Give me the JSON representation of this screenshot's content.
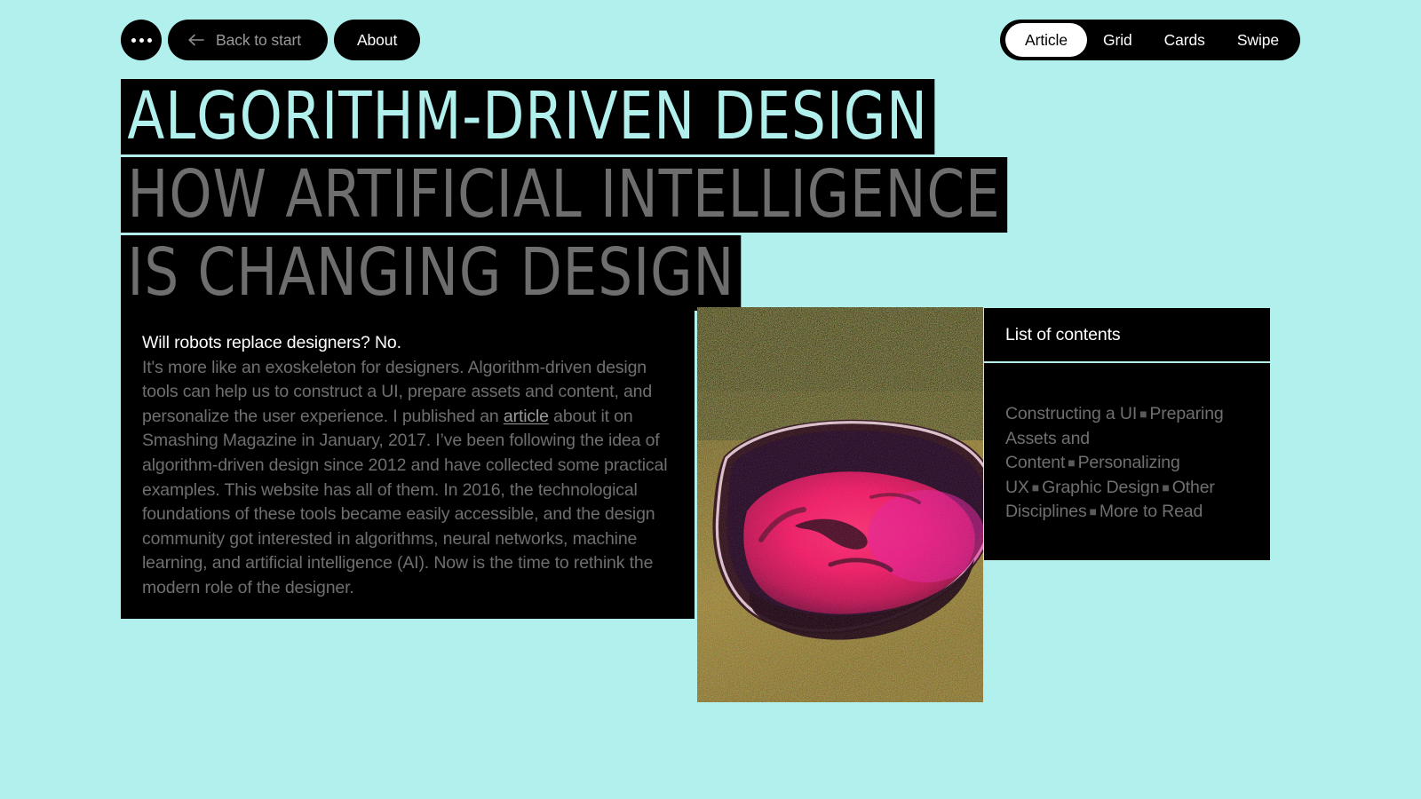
{
  "theme": {
    "background": "#b2f0ee",
    "panel": "#000000",
    "accent_cyan": "#b2f0ee",
    "text_muted": "#6f6f6f",
    "text_white": "#ffffff",
    "headline_gray": "#6e6e6e"
  },
  "topbar": {
    "menu_icon": "ellipsis-icon",
    "back": {
      "icon": "arrow-left-icon",
      "label": "Back to start"
    },
    "about_label": "About",
    "view_tabs": [
      {
        "label": "Article",
        "active": true
      },
      {
        "label": "Grid",
        "active": false
      },
      {
        "label": "Cards",
        "active": false
      },
      {
        "label": "Swipe",
        "active": false
      }
    ]
  },
  "headline": {
    "lines": [
      {
        "text": "ALGORITHM-DRIVEN DESIGN",
        "style": "cyan"
      },
      {
        "text": "HOW ARTIFICIAL INTELLIGENCE",
        "style": "gray"
      },
      {
        "text": "IS CHANGING DESIGN",
        "style": "gray"
      }
    ]
  },
  "article": {
    "lead": "Will robots replace designers? No.",
    "body_before_link": "It's more like an exoskeleton for designers. Algorithm-driven design tools can help us to construct a UI, prepare assets and content, and personalize the user experience. I published an ",
    "link_text": "article",
    "body_after_link": " about it on Smashing Magazine in January, 2017. I’ve been following the idea of algorithm-driven design since 2012 and have collected some practical examples. This website has all of them. In 2016, the technological foundations of these tools became easily accessible, and the design community got interested in algorithms, neural networks, machine learning, and artificial intelligence (AI). Now is the time to rethink the modern role of the designer."
  },
  "figure": {
    "name": "pink-lake-aerial-photo",
    "alt": "Aerial photograph of a bright pink lake surrounded by olive green terrain"
  },
  "toc": {
    "title": "List of contents",
    "separator": "■",
    "items": [
      "Constructing a UI",
      "Preparing Assets and Content",
      "Personalizing UX",
      "Graphic Design",
      "Other Disciplines",
      "More to Read"
    ]
  }
}
